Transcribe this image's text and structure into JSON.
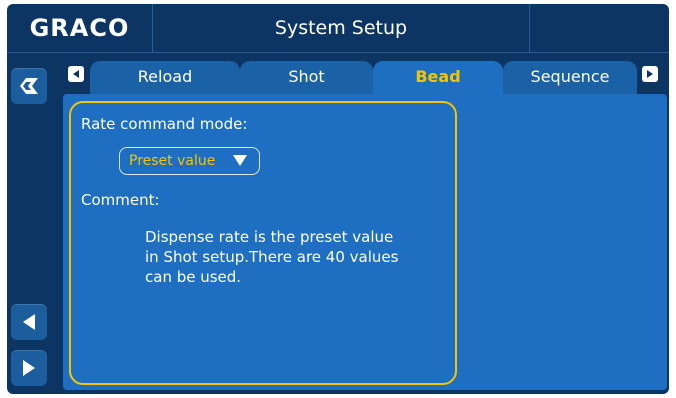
{
  "header": {
    "logo": "GRACO",
    "title": "System Setup"
  },
  "tabs": [
    {
      "label": "Reload",
      "active": false
    },
    {
      "label": "Shot",
      "active": false
    },
    {
      "label": "Bead",
      "active": true
    },
    {
      "label": "Sequence",
      "active": false
    }
  ],
  "settings": {
    "rate_label": "Rate command mode:",
    "rate_value": "Preset value",
    "comment_label": "Comment:",
    "comment_lines": [
      "Dispense rate is the preset value",
      "in Shot setup.There are 40 values",
      "can be used."
    ]
  },
  "icons": {
    "home": "graco-home-icon",
    "back": "left-arrow-icon",
    "forward": "right-arrow-icon"
  },
  "colors": {
    "background": "#0d3563",
    "panel": "#1e6fc1",
    "accent": "#f5c400",
    "tab": "#1b61a6"
  }
}
